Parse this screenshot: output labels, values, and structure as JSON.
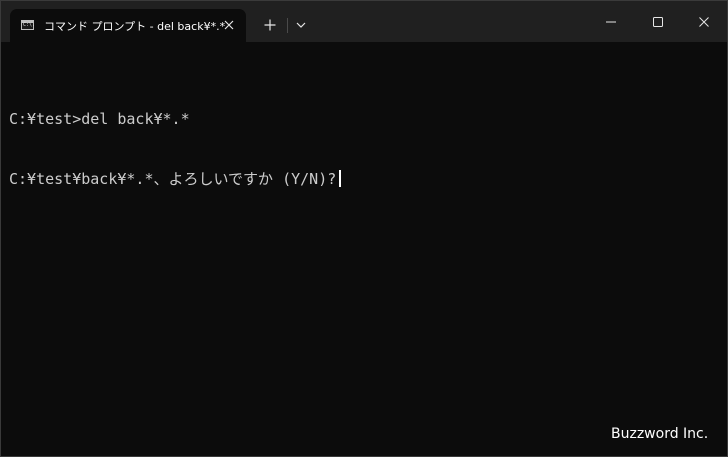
{
  "window": {
    "tab_title": "コマンド プロンプト - del  back¥*.*",
    "tab_icon_text": "C:\\.",
    "icons": {
      "tab_icon": "command-prompt-icon",
      "tab_close": "close-icon",
      "new_tab": "plus-icon",
      "dropdown": "chevron-down-icon",
      "minimize": "minimize-icon",
      "maximize": "maximize-icon",
      "close": "close-icon"
    }
  },
  "terminal": {
    "lines": [
      "C:¥test>del back¥*.*",
      "C:¥test¥back¥*.*、よろしいですか (Y/N)?"
    ]
  },
  "watermark": "Buzzword Inc.",
  "colors": {
    "background": "#0c0c0c",
    "titlebar": "#202020",
    "text": "#cccccc"
  }
}
